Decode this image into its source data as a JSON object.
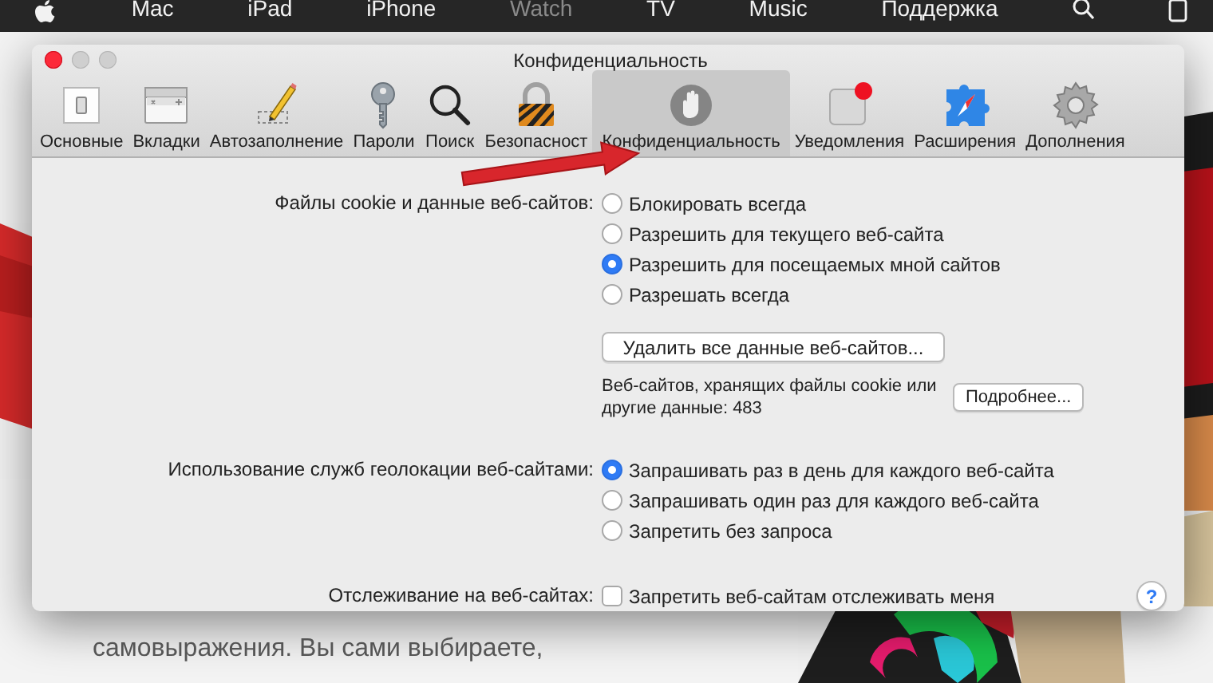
{
  "nav": {
    "items": [
      {
        "label": "Mac",
        "selected": false
      },
      {
        "label": "iPad",
        "selected": false
      },
      {
        "label": "iPhone",
        "selected": false
      },
      {
        "label": "Watch",
        "selected": true
      },
      {
        "label": "TV",
        "selected": false
      },
      {
        "label": "Music",
        "selected": false
      },
      {
        "label": "Поддержка",
        "selected": false
      }
    ]
  },
  "window": {
    "title": "Конфиденциальность"
  },
  "toolbar": {
    "tabs": [
      {
        "kind": "general",
        "label": "Основные",
        "selected": false
      },
      {
        "kind": "tabs",
        "label": "Вкладки",
        "selected": false
      },
      {
        "kind": "autofill",
        "label": "Автозаполнение",
        "selected": false
      },
      {
        "kind": "passwords",
        "label": "Пароли",
        "selected": false
      },
      {
        "kind": "search",
        "label": "Поиск",
        "selected": false
      },
      {
        "kind": "security",
        "label": "Безопасност",
        "selected": false
      },
      {
        "kind": "privacy",
        "label": "Конфиденциальность",
        "selected": true
      },
      {
        "kind": "notifications",
        "label": "Уведомления",
        "selected": false
      },
      {
        "kind": "extensions",
        "label": "Расширения",
        "selected": false
      },
      {
        "kind": "advanced",
        "label": "Дополнения",
        "selected": false
      }
    ]
  },
  "cookies": {
    "label": "Файлы cookie и данные веб-сайтов:",
    "options": [
      {
        "label": "Блокировать всегда",
        "selected": false
      },
      {
        "label": "Разрешить для текущего веб-сайта",
        "selected": false
      },
      {
        "label": "Разрешить для посещаемых мной сайтов",
        "selected": true
      },
      {
        "label": "Разрешать всегда",
        "selected": false
      }
    ]
  },
  "remove_button": "Удалить все данные веб-сайтов...",
  "stored_info": "Веб-сайтов, хранящих файлы cookie или другие данные: 483",
  "details_button": "Подробнее...",
  "location": {
    "label": "Использование служб геолокации веб-сайтами:",
    "options": [
      {
        "label": "Запрашивать раз в день для каждого веб-сайта",
        "selected": true
      },
      {
        "label": "Запрашивать один раз для каждого веб-сайта",
        "selected": false
      },
      {
        "label": "Запретить без запроса",
        "selected": false
      }
    ]
  },
  "tracking": {
    "label": "Отслеживание на веб-сайтах:",
    "checkbox": {
      "label": "Запретить веб-сайтам отслеживать меня",
      "checked": false
    }
  },
  "help_button": "?",
  "background_text": "самовыражения. Вы сами выбираете,"
}
